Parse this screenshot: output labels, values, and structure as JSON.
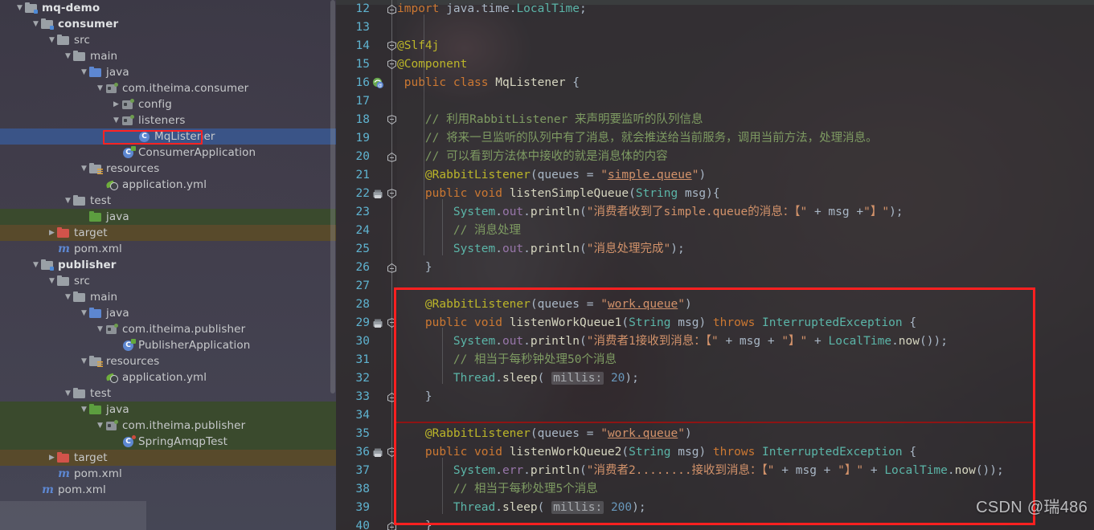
{
  "window": {
    "watermark": "CSDN @瑞486"
  },
  "sidebar": {
    "name": "project-tool-window",
    "scrollbar": true,
    "items": [
      {
        "label": "mq-demo",
        "indent": 0,
        "icon": "module-folder-icon",
        "twisty": "v",
        "bold": true,
        "row": ""
      },
      {
        "label": "consumer",
        "indent": 1,
        "icon": "module-folder-icon",
        "twisty": "v",
        "bold": true,
        "row": ""
      },
      {
        "label": "src",
        "indent": 2,
        "icon": "folder-grey-icon",
        "twisty": "v",
        "bold": false,
        "row": ""
      },
      {
        "label": "main",
        "indent": 3,
        "icon": "folder-grey-icon",
        "twisty": "v",
        "bold": false,
        "row": ""
      },
      {
        "label": "java",
        "indent": 4,
        "icon": "folder-blue-icon",
        "twisty": "v",
        "bold": false,
        "row": ""
      },
      {
        "label": "com.itheima.consumer",
        "indent": 5,
        "icon": "package-icon",
        "twisty": "v",
        "bold": false,
        "row": ""
      },
      {
        "label": "config",
        "indent": 6,
        "icon": "package-icon",
        "twisty": ">",
        "bold": false,
        "row": ""
      },
      {
        "label": "listeners",
        "indent": 6,
        "icon": "package-icon",
        "twisty": "v",
        "bold": false,
        "row": ""
      },
      {
        "label": "MqListener",
        "indent": 7,
        "icon": "class-icon",
        "twisty": "",
        "bold": false,
        "row": "selected"
      },
      {
        "label": "ConsumerApplication",
        "indent": 6,
        "icon": "spring-class-icon",
        "twisty": "",
        "bold": false,
        "row": ""
      },
      {
        "label": "resources",
        "indent": 4,
        "icon": "resources-folder-icon",
        "twisty": "v",
        "bold": false,
        "row": ""
      },
      {
        "label": "application.yml",
        "indent": 5,
        "icon": "yml-icon",
        "twisty": "",
        "bold": false,
        "row": ""
      },
      {
        "label": "test",
        "indent": 3,
        "icon": "folder-grey-icon",
        "twisty": "v",
        "bold": false,
        "row": ""
      },
      {
        "label": "java",
        "indent": 4,
        "icon": "folder-green-icon",
        "twisty": "",
        "bold": false,
        "row": "green"
      },
      {
        "label": "target",
        "indent": 2,
        "icon": "folder-red-icon",
        "twisty": ">",
        "bold": false,
        "row": "olive"
      },
      {
        "label": "pom.xml",
        "indent": 2,
        "icon": "maven-icon",
        "twisty": "",
        "bold": false,
        "row": ""
      },
      {
        "label": "publisher",
        "indent": 1,
        "icon": "module-folder-icon",
        "twisty": "v",
        "bold": true,
        "row": ""
      },
      {
        "label": "src",
        "indent": 2,
        "icon": "folder-grey-icon",
        "twisty": "v",
        "bold": false,
        "row": ""
      },
      {
        "label": "main",
        "indent": 3,
        "icon": "folder-grey-icon",
        "twisty": "v",
        "bold": false,
        "row": ""
      },
      {
        "label": "java",
        "indent": 4,
        "icon": "folder-blue-icon",
        "twisty": "v",
        "bold": false,
        "row": ""
      },
      {
        "label": "com.itheima.publisher",
        "indent": 5,
        "icon": "package-icon",
        "twisty": "v",
        "bold": false,
        "row": ""
      },
      {
        "label": "PublisherApplication",
        "indent": 6,
        "icon": "spring-class-icon",
        "twisty": "",
        "bold": false,
        "row": ""
      },
      {
        "label": "resources",
        "indent": 4,
        "icon": "resources-folder-icon",
        "twisty": "v",
        "bold": false,
        "row": ""
      },
      {
        "label": "application.yml",
        "indent": 5,
        "icon": "yml-icon",
        "twisty": "",
        "bold": false,
        "row": ""
      },
      {
        "label": "test",
        "indent": 3,
        "icon": "folder-grey-icon",
        "twisty": "v",
        "bold": false,
        "row": ""
      },
      {
        "label": "java",
        "indent": 4,
        "icon": "folder-green-icon",
        "twisty": "v",
        "bold": false,
        "row": "green"
      },
      {
        "label": "com.itheima.publisher",
        "indent": 5,
        "icon": "package-icon",
        "twisty": "v",
        "bold": false,
        "row": "green"
      },
      {
        "label": "SpringAmqpTest",
        "indent": 6,
        "icon": "test-class-icon",
        "twisty": "",
        "bold": false,
        "row": "green"
      },
      {
        "label": "target",
        "indent": 2,
        "icon": "folder-red-icon",
        "twisty": ">",
        "bold": false,
        "row": "olive"
      },
      {
        "label": "pom.xml",
        "indent": 2,
        "icon": "maven-icon",
        "twisty": "",
        "bold": false,
        "row": ""
      },
      {
        "label": "pom.xml",
        "indent": 1,
        "icon": "maven-icon",
        "twisty": "",
        "bold": false,
        "row": ""
      }
    ]
  },
  "editor": {
    "name": "code-editor-MqListener-java",
    "first_line": 12,
    "lines": [
      {
        "n": 12,
        "fold": "end-top",
        "gicon": "",
        "html": "<span class='kw'>import</span> <span class='plain'>java</span><span class='plain'>.</span><span class='plain'>time</span><span class='plain'>.</span><span class='cls2'>LocalTime</span><span class='plain'>;</span>"
      },
      {
        "n": 13,
        "fold": "",
        "gicon": "",
        "html": ""
      },
      {
        "n": 14,
        "fold": "open",
        "gicon": "",
        "html": "<span class='anno'>@Slf4j</span>"
      },
      {
        "n": 15,
        "fold": "open",
        "gicon": "",
        "html": "<span class='anno'>@Component</span>"
      },
      {
        "n": 16,
        "fold": "",
        "gicon": "spring",
        "html": " <span class='kw'>public</span> <span class='kw'>class</span> <span class='method'>MqListener</span> <span class='plain'>{</span>"
      },
      {
        "n": 17,
        "fold": "",
        "gicon": "",
        "html": ""
      },
      {
        "n": 18,
        "fold": "open",
        "gicon": "",
        "html": "    <span class='cmt'>// 利用RabbitListener 来声明要监听的队列信息</span>"
      },
      {
        "n": 19,
        "fold": "",
        "gicon": "",
        "html": "    <span class='cmt'>// 将来一旦监听的队列中有了消息，就会推送给当前服务，调用当前方法，处理消息。</span>"
      },
      {
        "n": 20,
        "fold": "end",
        "gicon": "",
        "html": "    <span class='cmt'>// 可以看到方法体中接收的就是消息体的内容</span>"
      },
      {
        "n": 21,
        "fold": "",
        "gicon": "",
        "html": "    <span class='anno'>@RabbitListener</span><span class='plain'>(</span><span class='plain'>queues</span> <span class='plain'>=</span> <span class='str'>\"</span><span class='strlink'>simple.queue</span><span class='str'>\"</span><span class='plain'>)</span>"
      },
      {
        "n": 22,
        "fold": "open",
        "gicon": "override",
        "html": "    <span class='kw'>public</span> <span class='kw'>void</span> <span class='method'>listenSimpleQueue</span><span class='plain'>(</span><span class='cls2'>String</span> <span class='param'>msg</span><span class='plain'>){</span>"
      },
      {
        "n": 23,
        "fold": "",
        "gicon": "",
        "html": "        <span class='cls2'>System</span><span class='plain'>.</span><span class='var'>out</span><span class='plain'>.</span><span class='method'>println</span><span class='plain'>(</span><span class='str'>\"消费者收到了simple.queue的消息：【\"</span> <span class='plain'>+</span> <span class='param'>msg</span> <span class='plain'>+</span><span class='str'>\"】\"</span><span class='plain'>);</span>"
      },
      {
        "n": 24,
        "fold": "",
        "gicon": "",
        "html": "        <span class='cmt'>// 消息处理</span>"
      },
      {
        "n": 25,
        "fold": "",
        "gicon": "",
        "html": "        <span class='cls2'>System</span><span class='plain'>.</span><span class='var'>out</span><span class='plain'>.</span><span class='method'>println</span><span class='plain'>(</span><span class='str'>\"消息处理完成\"</span><span class='plain'>);</span>"
      },
      {
        "n": 26,
        "fold": "end",
        "gicon": "",
        "html": "    <span class='plain'>}</span>"
      },
      {
        "n": 27,
        "fold": "",
        "gicon": "",
        "html": ""
      },
      {
        "n": 28,
        "fold": "",
        "gicon": "",
        "html": "    <span class='anno'>@RabbitListener</span><span class='plain'>(</span><span class='plain'>queues</span> <span class='plain'>=</span> <span class='str'>\"</span><span class='strlink'>work.queue</span><span class='str'>\"</span><span class='plain'>)</span>"
      },
      {
        "n": 29,
        "fold": "open",
        "gicon": "override",
        "html": "    <span class='kw'>public</span> <span class='kw'>void</span> <span class='method'>listenWorkQueue1</span><span class='plain'>(</span><span class='cls2'>String</span> <span class='param'>msg</span><span class='plain'>)</span> <span class='kw'>throws</span> <span class='cls2'>InterruptedException</span> <span class='plain'>{</span>"
      },
      {
        "n": 30,
        "fold": "",
        "gicon": "",
        "html": "        <span class='cls2'>System</span><span class='plain'>.</span><span class='var'>out</span><span class='plain'>.</span><span class='method'>println</span><span class='plain'>(</span><span class='str'>\"消费者1接收到消息：【\"</span> <span class='plain'>+</span> <span class='param'>msg</span> <span class='plain'>+</span> <span class='str'>\"】\"</span> <span class='plain'>+</span> <span class='cls2'>LocalTime</span><span class='plain'>.</span><span class='method'>now</span><span class='plain'>());</span>"
      },
      {
        "n": 31,
        "fold": "",
        "gicon": "",
        "html": "        <span class='cmt'>// 相当于每秒钟处理50个消息</span>"
      },
      {
        "n": 32,
        "fold": "",
        "gicon": "",
        "html": "        <span class='cls2'>Thread</span><span class='plain'>.</span><span class='method'>sleep</span><span class='plain'>(</span> <span class='hint'>millis:</span> <span class='num'>20</span><span class='plain'>);</span>"
      },
      {
        "n": 33,
        "fold": "end",
        "gicon": "",
        "html": "    <span class='plain'>}</span>"
      },
      {
        "n": 34,
        "fold": "",
        "gicon": "",
        "html": ""
      },
      {
        "n": 35,
        "fold": "",
        "gicon": "",
        "html": "    <span class='anno'>@RabbitListener</span><span class='plain'>(</span><span class='plain'>queues</span> <span class='plain'>=</span> <span class='str'>\"</span><span class='strlink'>work.queue</span><span class='str'>\"</span><span class='plain'>)</span>"
      },
      {
        "n": 36,
        "fold": "open",
        "gicon": "override",
        "html": "    <span class='kw'>public</span> <span class='kw'>void</span> <span class='method'>listenWorkQueue2</span><span class='plain'>(</span><span class='cls2'>String</span> <span class='param'>msg</span><span class='plain'>)</span> <span class='kw'>throws</span> <span class='cls2'>InterruptedException</span> <span class='plain'>{</span>"
      },
      {
        "n": 37,
        "fold": "",
        "gicon": "",
        "html": "        <span class='cls2'>System</span><span class='plain'>.</span><span class='var'>err</span><span class='plain'>.</span><span class='method'>println</span><span class='plain'>(</span><span class='str'>\"消费者2........接收到消息：【\"</span> <span class='plain'>+</span> <span class='param'>msg</span> <span class='plain'>+</span> <span class='str'>\"】\"</span> <span class='plain'>+</span> <span class='cls2'>LocalTime</span><span class='plain'>.</span><span class='method'>now</span><span class='plain'>());</span>"
      },
      {
        "n": 38,
        "fold": "",
        "gicon": "",
        "html": "        <span class='cmt'>// 相当于每秒处理5个消息</span>"
      },
      {
        "n": 39,
        "fold": "",
        "gicon": "",
        "html": "        <span class='cls2'>Thread</span><span class='plain'>.</span><span class='method'>sleep</span><span class='plain'>(</span> <span class='hint'>millis:</span> <span class='num'>200</span><span class='plain'>);</span>"
      },
      {
        "n": 40,
        "fold": "end",
        "gicon": "",
        "html": "    <span class='plain'>}</span>"
      }
    ],
    "annotations": {
      "red_box_label": "work-queue-listeners-highlight",
      "mqlistener_box_label": "mqlistener-file-highlight",
      "accent_red": "#fe2020"
    }
  }
}
